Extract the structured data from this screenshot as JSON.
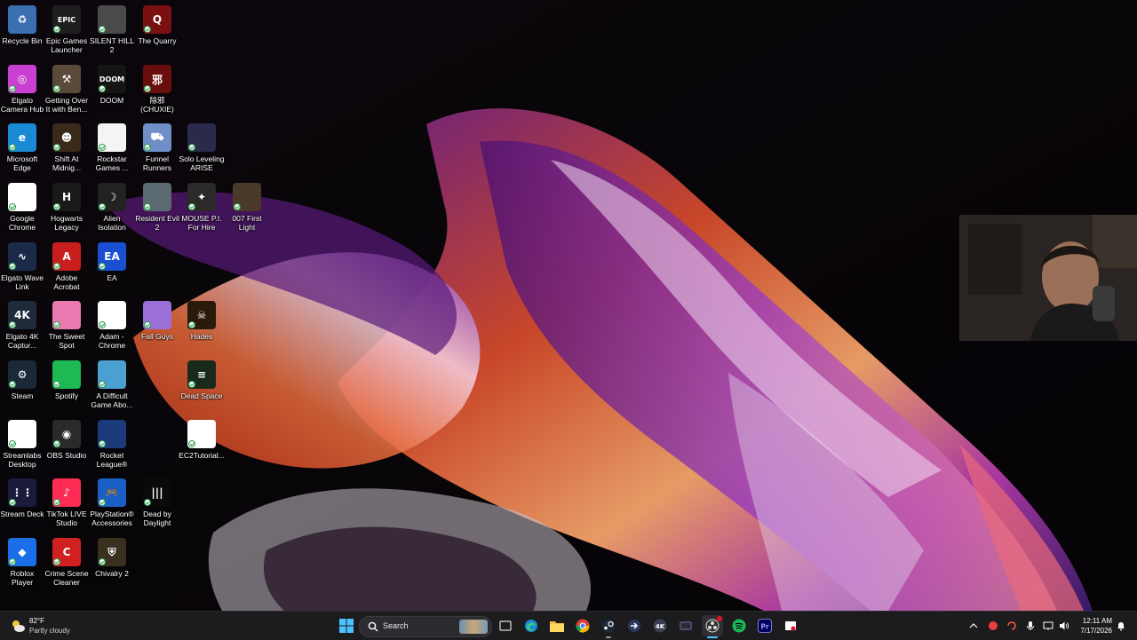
{
  "desktop": {
    "icons": [
      {
        "label": "Recycle Bin",
        "icon": "recycle-bin-icon",
        "bg": "#3a6fb0",
        "glyph": "♻"
      },
      {
        "label": "Epic Games Launcher",
        "icon": "epic-games-icon",
        "bg": "#1f1f1f",
        "glyph": "EPIC"
      },
      {
        "label": "SILENT HILL 2",
        "icon": "silent-hill-2-icon",
        "bg": "#4a4a4a",
        "glyph": ""
      },
      {
        "label": "The Quarry",
        "icon": "the-quarry-icon",
        "bg": "#7a1010",
        "glyph": "Q"
      },
      {
        "label": "Elgato Camera Hub",
        "icon": "elgato-camera-hub-icon",
        "bg": "#c83fd1",
        "glyph": "◎"
      },
      {
        "label": "Getting Over It with Ben...",
        "icon": "getting-over-it-icon",
        "bg": "#5a4a3a",
        "glyph": "⚒"
      },
      {
        "label": "DOOM",
        "icon": "doom-icon",
        "bg": "#151515",
        "glyph": "DOOM"
      },
      {
        "label": "除邪 (CHUXIE)",
        "icon": "chuxie-icon",
        "bg": "#6a0d0d",
        "glyph": "邪"
      },
      {
        "label": "Microsoft Edge",
        "icon": "microsoft-edge-icon",
        "bg": "#1a8ad4",
        "glyph": "e"
      },
      {
        "label": "Shift At Midnig...",
        "icon": "shift-at-midnight-icon",
        "bg": "#3a2a1a",
        "glyph": "☻"
      },
      {
        "label": "Rockstar Games ...",
        "icon": "rockstar-games-file-icon",
        "bg": "#f4f4f4",
        "glyph": ""
      },
      {
        "label": "Funnel Runners",
        "icon": "funnel-runners-icon",
        "bg": "#6f8fc8",
        "glyph": "⛟"
      },
      {
        "label": "Solo Leveling ARISE OVE...",
        "icon": "solo-leveling-icon",
        "bg": "#2a2a4a",
        "glyph": ""
      },
      {
        "label": "Google Chrome",
        "icon": "google-chrome-icon",
        "bg": "#ffffff",
        "glyph": ""
      },
      {
        "label": "Hogwarts Legacy",
        "icon": "hogwarts-legacy-icon",
        "bg": "#1a1a1a",
        "glyph": "H"
      },
      {
        "label": "Alien Isolation",
        "icon": "alien-isolation-icon",
        "bg": "#222222",
        "glyph": "☽"
      },
      {
        "label": "Resident Evil 2",
        "icon": "resident-evil-2-icon",
        "bg": "#5a6a70",
        "glyph": ""
      },
      {
        "label": "MOUSE P.I. For Hire",
        "icon": "mouse-pi-icon",
        "bg": "#2a2a2a",
        "glyph": "✦"
      },
      {
        "label": "007 First Light",
        "icon": "007-first-light-icon",
        "bg": "#4a3a2a",
        "glyph": ""
      },
      {
        "label": "Elgato Wave Link",
        "icon": "elgato-wave-link-icon",
        "bg": "#1c2a4a",
        "glyph": "∿"
      },
      {
        "label": "Adobe Acrobat",
        "icon": "adobe-acrobat-icon",
        "bg": "#c81e1e",
        "glyph": "A"
      },
      {
        "label": "EA",
        "icon": "ea-icon",
        "bg": "#1a4fd4",
        "glyph": "EA"
      },
      {
        "label": "Elgato 4K Captur...",
        "icon": "elgato-4k-capture-icon",
        "bg": "#1f2a3a",
        "glyph": "4K"
      },
      {
        "label": "The Sweet Spot",
        "icon": "the-sweet-spot-icon",
        "bg": "#e87ab0",
        "glyph": ""
      },
      {
        "label": "Adam - Chrome",
        "icon": "adam-chrome-icon",
        "bg": "#ffffff",
        "glyph": ""
      },
      {
        "label": "Fall Guys",
        "icon": "fall-guys-icon",
        "bg": "#9b6fd8",
        "glyph": ""
      },
      {
        "label": "Hades",
        "icon": "hades-icon",
        "bg": "#2a1a0a",
        "glyph": "☠"
      },
      {
        "label": "Steam",
        "icon": "steam-icon",
        "bg": "#1b2838",
        "glyph": "⚙"
      },
      {
        "label": "Spotify",
        "icon": "spotify-icon",
        "bg": "#1db954",
        "glyph": ""
      },
      {
        "label": "A Difficult Game Abo...",
        "icon": "a-difficult-game-icon",
        "bg": "#4aa0d0",
        "glyph": ""
      },
      {
        "label": "Dead Space",
        "icon": "dead-space-icon",
        "bg": "#1a2a1a",
        "glyph": "≡"
      },
      {
        "label": "Streamlabs Desktop",
        "icon": "streamlabs-icon",
        "bg": "#ffffff",
        "glyph": ""
      },
      {
        "label": "OBS Studio",
        "icon": "obs-studio-icon",
        "bg": "#2a2a2a",
        "glyph": "◉"
      },
      {
        "label": "Rocket League®",
        "icon": "rocket-league-icon",
        "bg": "#1a3a7a",
        "glyph": ""
      },
      {
        "label": "EC2Tutorial...",
        "icon": "ec2-tutorial-file-icon",
        "bg": "#ffffff",
        "glyph": ""
      },
      {
        "label": "Stream Deck",
        "icon": "stream-deck-icon",
        "bg": "#1a1a3a",
        "glyph": "⋮⋮"
      },
      {
        "label": "TikTok LIVE Studio",
        "icon": "tiktok-live-studio-icon",
        "bg": "#ff2d55",
        "glyph": "♪"
      },
      {
        "label": "PlayStation® Accessories",
        "icon": "playstation-accessories-icon",
        "bg": "#1a5fc8",
        "glyph": "🎮"
      },
      {
        "label": "Dead by Daylight",
        "icon": "dead-by-daylight-icon",
        "bg": "#0a0a0a",
        "glyph": "|||"
      },
      {
        "label": "Roblox Player",
        "icon": "roblox-player-icon",
        "bg": "#1a6fe8",
        "glyph": "◆"
      },
      {
        "label": "Crime Scene Cleaner",
        "icon": "crime-scene-cleaner-icon",
        "bg": "#d02020",
        "glyph": "C"
      },
      {
        "label": "Chivalry 2",
        "icon": "chivalry-2-icon",
        "bg": "#3a3020",
        "glyph": "⛨"
      }
    ]
  },
  "taskbar": {
    "weather": {
      "temp": "82°F",
      "desc": "Partly cloudy"
    },
    "search_label": "Search",
    "apps": [
      "start-button",
      "search-box",
      "task-view-icon",
      "edge-taskbar-icon",
      "file-explorer-icon",
      "chrome-taskbar-icon",
      "steam-taskbar-icon",
      "arrow-app-icon",
      "elgato-4k-taskbar-icon",
      "monitor-app-icon",
      "obs-taskbar-icon",
      "spotify-taskbar-icon",
      "premiere-pro-icon",
      "snipping-tool-icon"
    ],
    "clock": {
      "time": "12:11 AM",
      "date": "7/17/2026"
    }
  },
  "colors": {
    "taskbar_bg": "#1c1c1f",
    "accent_blue": "#0078d4"
  }
}
